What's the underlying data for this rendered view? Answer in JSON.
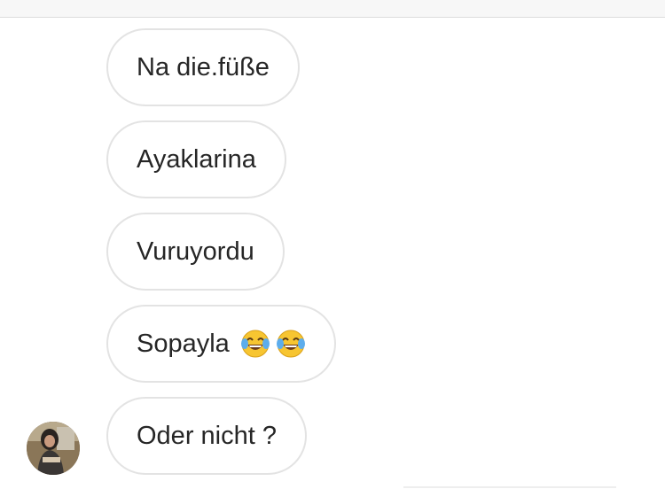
{
  "messages": [
    {
      "text": "Na die.füße"
    },
    {
      "text": "Ayaklarina"
    },
    {
      "text": "Vuruyordu"
    },
    {
      "text": "Sopayla",
      "emojis": [
        "face-with-tears-of-joy-icon",
        "face-with-tears-of-joy-icon"
      ]
    },
    {
      "text": "Oder nicht ?"
    }
  ],
  "colors": {
    "bubble_border": "#e3e3e3",
    "text": "#262626",
    "emoji_face": "#f7c531",
    "emoji_tear": "#5dadec"
  }
}
